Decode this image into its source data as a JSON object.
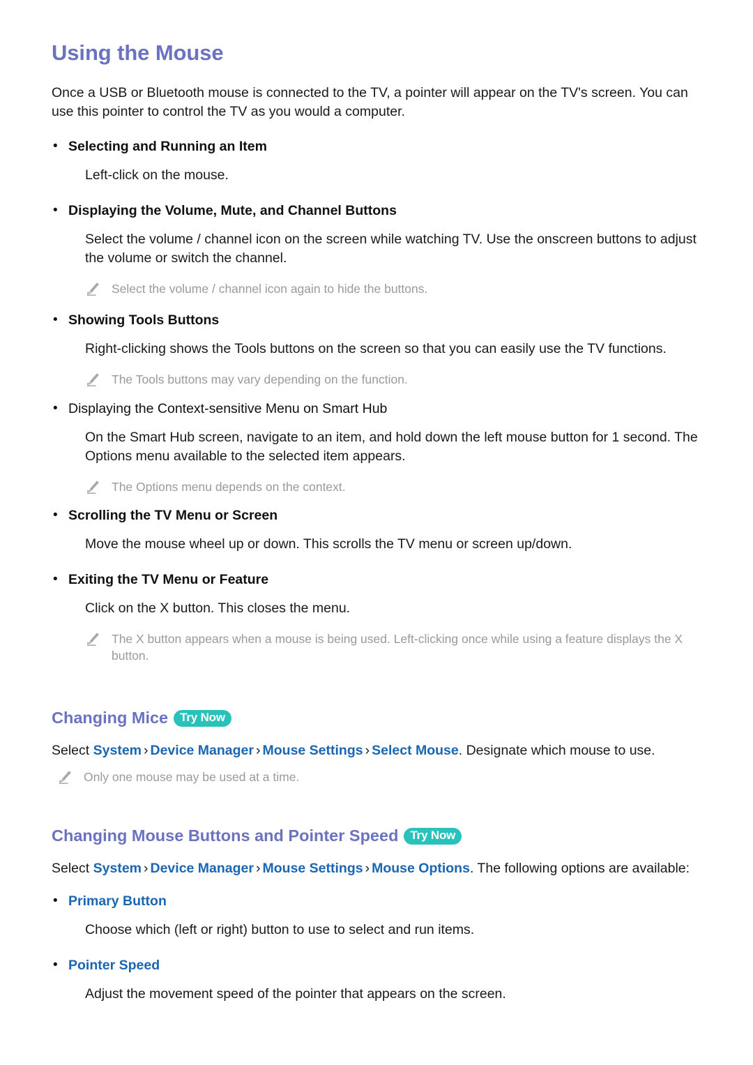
{
  "page": {
    "title": "Using the Mouse",
    "intro": "Once a USB or Bluetooth mouse is connected to the TV, a pointer will appear on the TV's screen. You can use this pointer to control the TV as you would a computer."
  },
  "bullets": [
    {
      "label": "Selecting and Running an Item",
      "style": "bold",
      "body": "Left-click on the mouse.",
      "note": null
    },
    {
      "label": "Displaying the Volume, Mute, and Channel Buttons",
      "style": "bold",
      "body": "Select the volume / channel icon on the screen while watching TV. Use the onscreen buttons to adjust the volume or switch the channel.",
      "note": "Select the volume / channel icon again to hide the buttons."
    },
    {
      "label": "Showing Tools Buttons",
      "style": "bold",
      "body": "Right-clicking shows the Tools buttons on the screen so that you can easily use the TV functions.",
      "note": "The Tools buttons may vary depending on the function."
    },
    {
      "label": "Displaying the Context-sensitive Menu on Smart Hub",
      "style": "plain",
      "body": "On the Smart Hub screen, navigate to an item, and hold down the left mouse button for 1 second. The Options menu available to the selected item appears.",
      "note": "The Options menu depends on the context."
    },
    {
      "label": "Scrolling the TV Menu or Screen",
      "style": "bold",
      "body": "Move the mouse wheel up or down. This scrolls the TV menu or screen up/down.",
      "note": null
    },
    {
      "label": "Exiting the TV Menu or Feature",
      "style": "bold",
      "body": "Click on the X button. This closes the menu.",
      "note": "The X button appears when a mouse is being used. Left-clicking once while using a feature displays the X button."
    }
  ],
  "sections": [
    {
      "title": "Changing Mice",
      "badge": "Try Now",
      "path_prefix": "Select",
      "path_items": [
        "System",
        "Device Manager",
        "Mouse Settings",
        "Select Mouse"
      ],
      "path_separator": "›",
      "path_suffix": ". Designate which mouse to use.",
      "note": "Only one mouse may be used at a time."
    },
    {
      "title": "Changing Mouse Buttons and Pointer Speed",
      "badge": "Try Now",
      "path_prefix": "Select",
      "path_items": [
        "System",
        "Device Manager",
        "Mouse Settings",
        "Mouse Options"
      ],
      "path_separator": "›",
      "path_suffix": ". The following options are available:",
      "note": null
    }
  ],
  "option_bullets": [
    {
      "label": "Primary Button",
      "body": "Choose which (left or right) button to use to select and run items."
    },
    {
      "label": "Pointer Speed",
      "body": "Adjust the movement speed of the pointer that appears on the screen."
    }
  ],
  "icons": {
    "bullet": "•",
    "note": "pencil-icon"
  },
  "colors": {
    "heading": "#6b72c0",
    "menu_link": "#1a66b3",
    "badge_bg": "#29c2bb",
    "note_text": "#9a9a9a",
    "body_text": "#1a1a1a"
  }
}
